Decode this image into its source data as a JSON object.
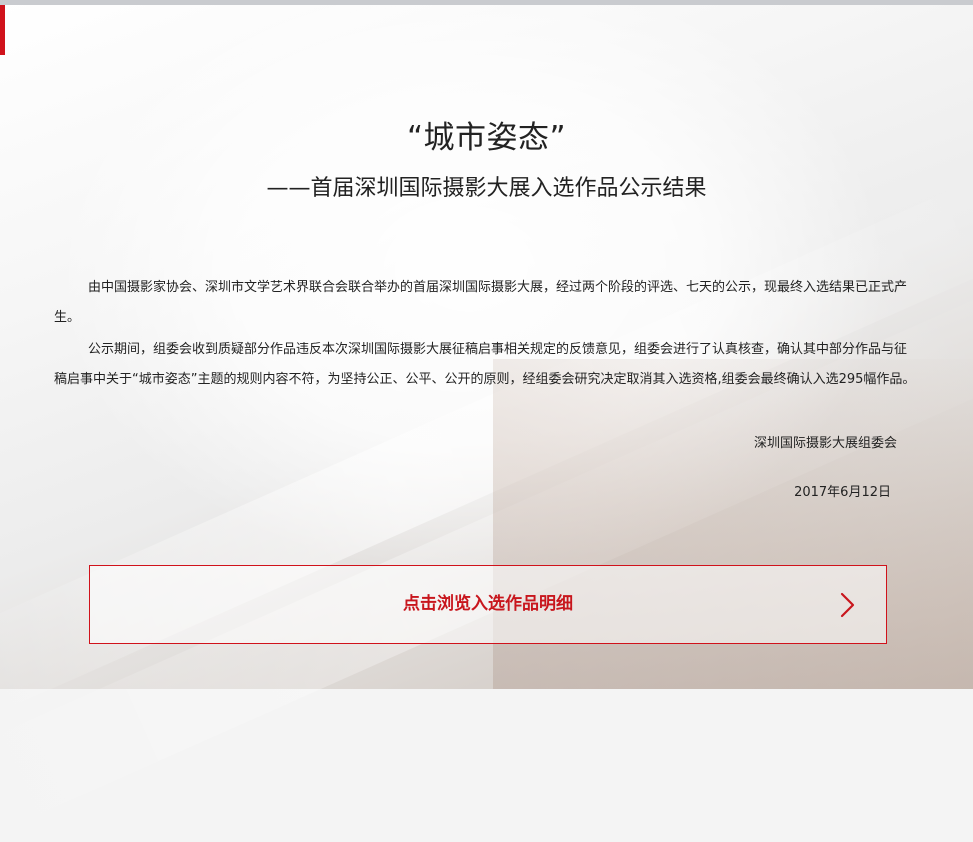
{
  "header": {
    "title": "“城市姿态”",
    "subtitle": "——首届深圳国际摄影大展入选作品公示结果"
  },
  "body": {
    "paragraphs": [
      "由中国摄影家协会、深圳市文学艺术界联合会联合举办的首届深圳国际摄影大展，经过两个阶段的评选、七天的公示，现最终入选结果已正式产生。",
      "公示期间，组委会收到质疑部分作品违反本次深圳国际摄影大展征稿启事相关规定的反馈意见，组委会进行了认真核查，确认其中部分作品与征稿启事中关于“城市姿态”主题的规则内容不符，为坚持公正、公平、公开的原则，经组委会研究决定取消其入选资格,组委会最终确认入选295幅作品。"
    ],
    "signature": "深圳国际摄影大展组委会",
    "date": "2017年6月12日"
  },
  "action": {
    "browse_label": "点击浏览入选作品明细",
    "icon": "chevron-right-icon"
  },
  "colors": {
    "accent": "#d0121b",
    "button_text": "#c8161d",
    "text": "#222222"
  }
}
